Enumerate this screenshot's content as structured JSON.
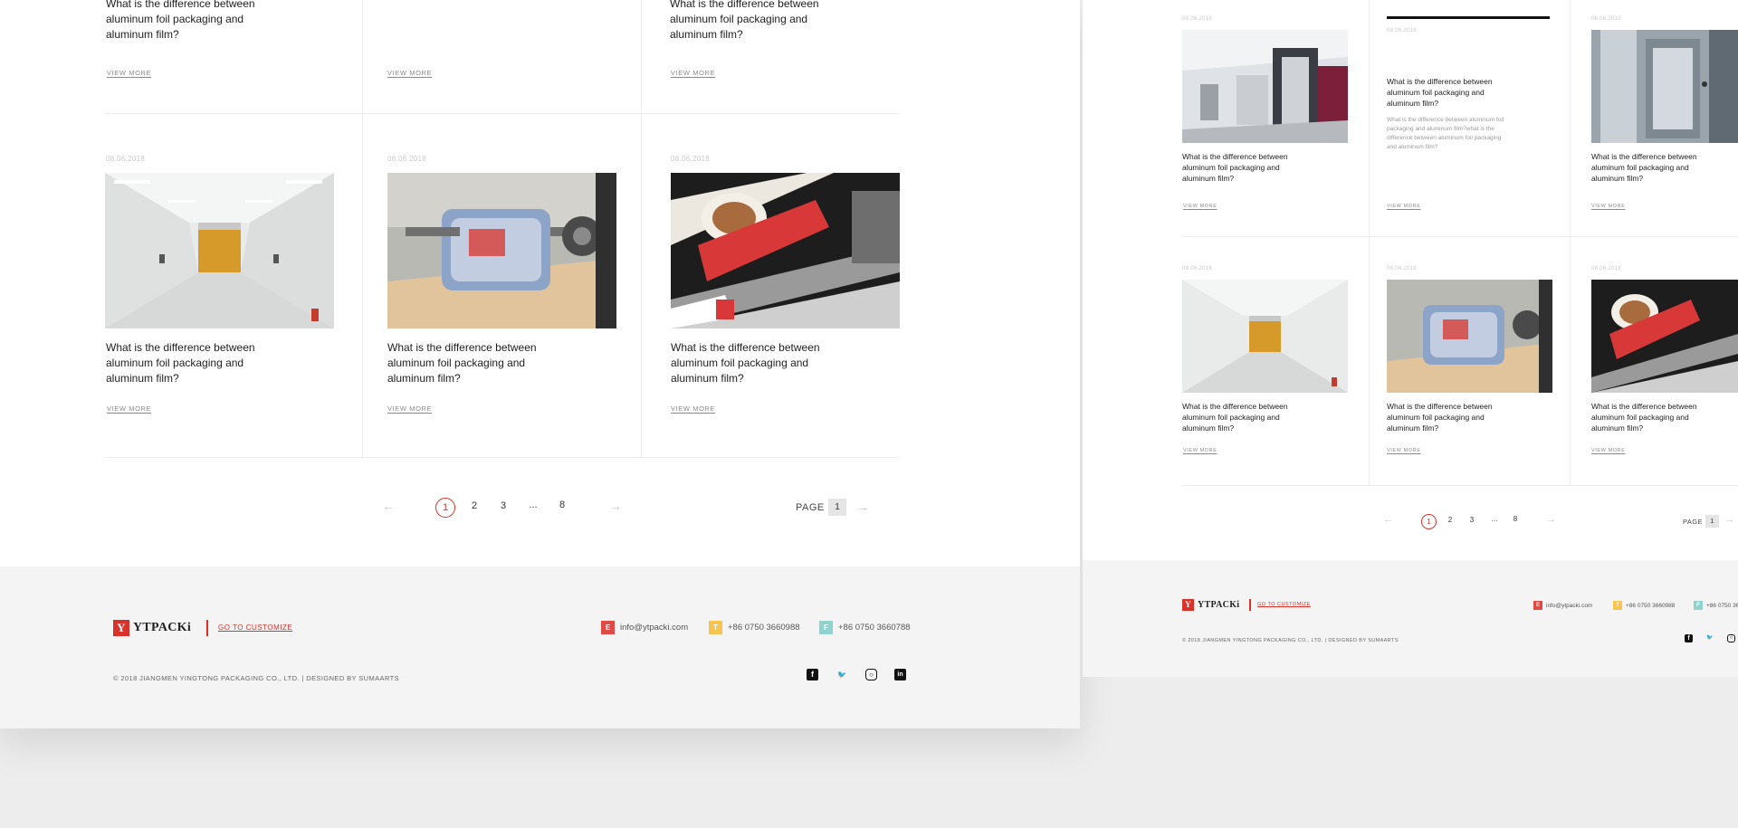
{
  "article_title": "What is the difference between aluminum foil packaging and aluminum film?",
  "article_excerpt": "What is the difference between aluminum foil packaging and aluminum film?what is the difference between aluminum foil packaging and aluminum film?",
  "date": "08.06.2018",
  "view_more": "VIEW MORE",
  "pagination": {
    "prev": "←",
    "next": "→",
    "pages": [
      "1",
      "2",
      "3",
      "...",
      "8"
    ],
    "page_label": "PAGE",
    "page_value": "1"
  },
  "footer": {
    "logo_mark": "Y",
    "logo_text": "YTPACKi",
    "customize": "GO TO CUSTOMIZE",
    "email_badge": "E",
    "email": "info@ytpacki.com",
    "tel_badge": "T",
    "tel": "+86 0750 3660988",
    "fax_badge": "F",
    "fax": "+86 0750 3660788",
    "copyright": "© 2018 JIANGMEN YINGTONG PACKAGING CO., LTD. | DESIGNED BY SUMAARTS",
    "social": [
      "facebook-icon",
      "twitter-icon",
      "instagram-icon",
      "linkedin-icon"
    ]
  },
  "colors": {
    "accent": "#d8322b",
    "email_badge": "#e04a45",
    "tel_badge": "#f6c44f",
    "fax_badge": "#8fd3cf"
  }
}
